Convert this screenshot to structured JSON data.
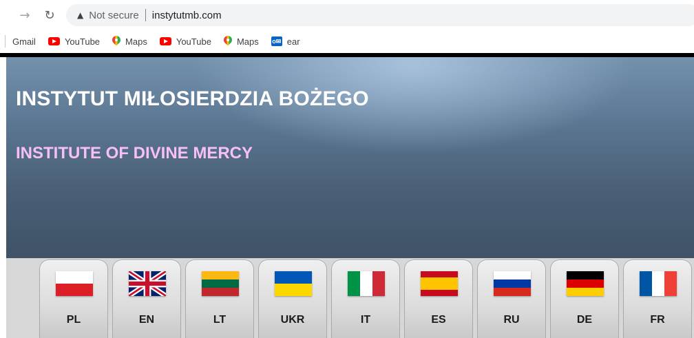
{
  "browser": {
    "security_label": "Not secure",
    "url": "instytutmb.com",
    "icons": {
      "back": "arrow-right-icon",
      "reload": "reload-icon",
      "warning": "warning-triangle-icon"
    }
  },
  "bookmarks": [
    {
      "label": "Gmail",
      "icon": "none"
    },
    {
      "label": "YouTube",
      "icon": "youtube-icon"
    },
    {
      "label": "Maps",
      "icon": "maps-pin-icon"
    },
    {
      "label": "YouTube",
      "icon": "youtube-icon"
    },
    {
      "label": "Maps",
      "icon": "maps-pin-icon"
    },
    {
      "label": "ear",
      "icon": "outlook-icon"
    }
  ],
  "site": {
    "title_pl": "INSTYTUT MIŁOSIERDZIA BOŻEGO",
    "title_en": "INSTITUTE OF DIVINE MERCY",
    "colors": {
      "title_pl": "#ffffff",
      "title_en": "#f6c0f4",
      "header_bg": "#4f667d"
    }
  },
  "languages": [
    {
      "code": "PL",
      "flag": "poland-flag-icon"
    },
    {
      "code": "EN",
      "flag": "uk-flag-icon"
    },
    {
      "code": "LT",
      "flag": "lithuania-flag-icon"
    },
    {
      "code": "UKR",
      "flag": "ukraine-flag-icon"
    },
    {
      "code": "IT",
      "flag": "italy-flag-icon"
    },
    {
      "code": "ES",
      "flag": "spain-flag-icon"
    },
    {
      "code": "RU",
      "flag": "russia-flag-icon"
    },
    {
      "code": "DE",
      "flag": "germany-flag-icon"
    },
    {
      "code": "FR",
      "flag": "france-flag-icon"
    }
  ]
}
